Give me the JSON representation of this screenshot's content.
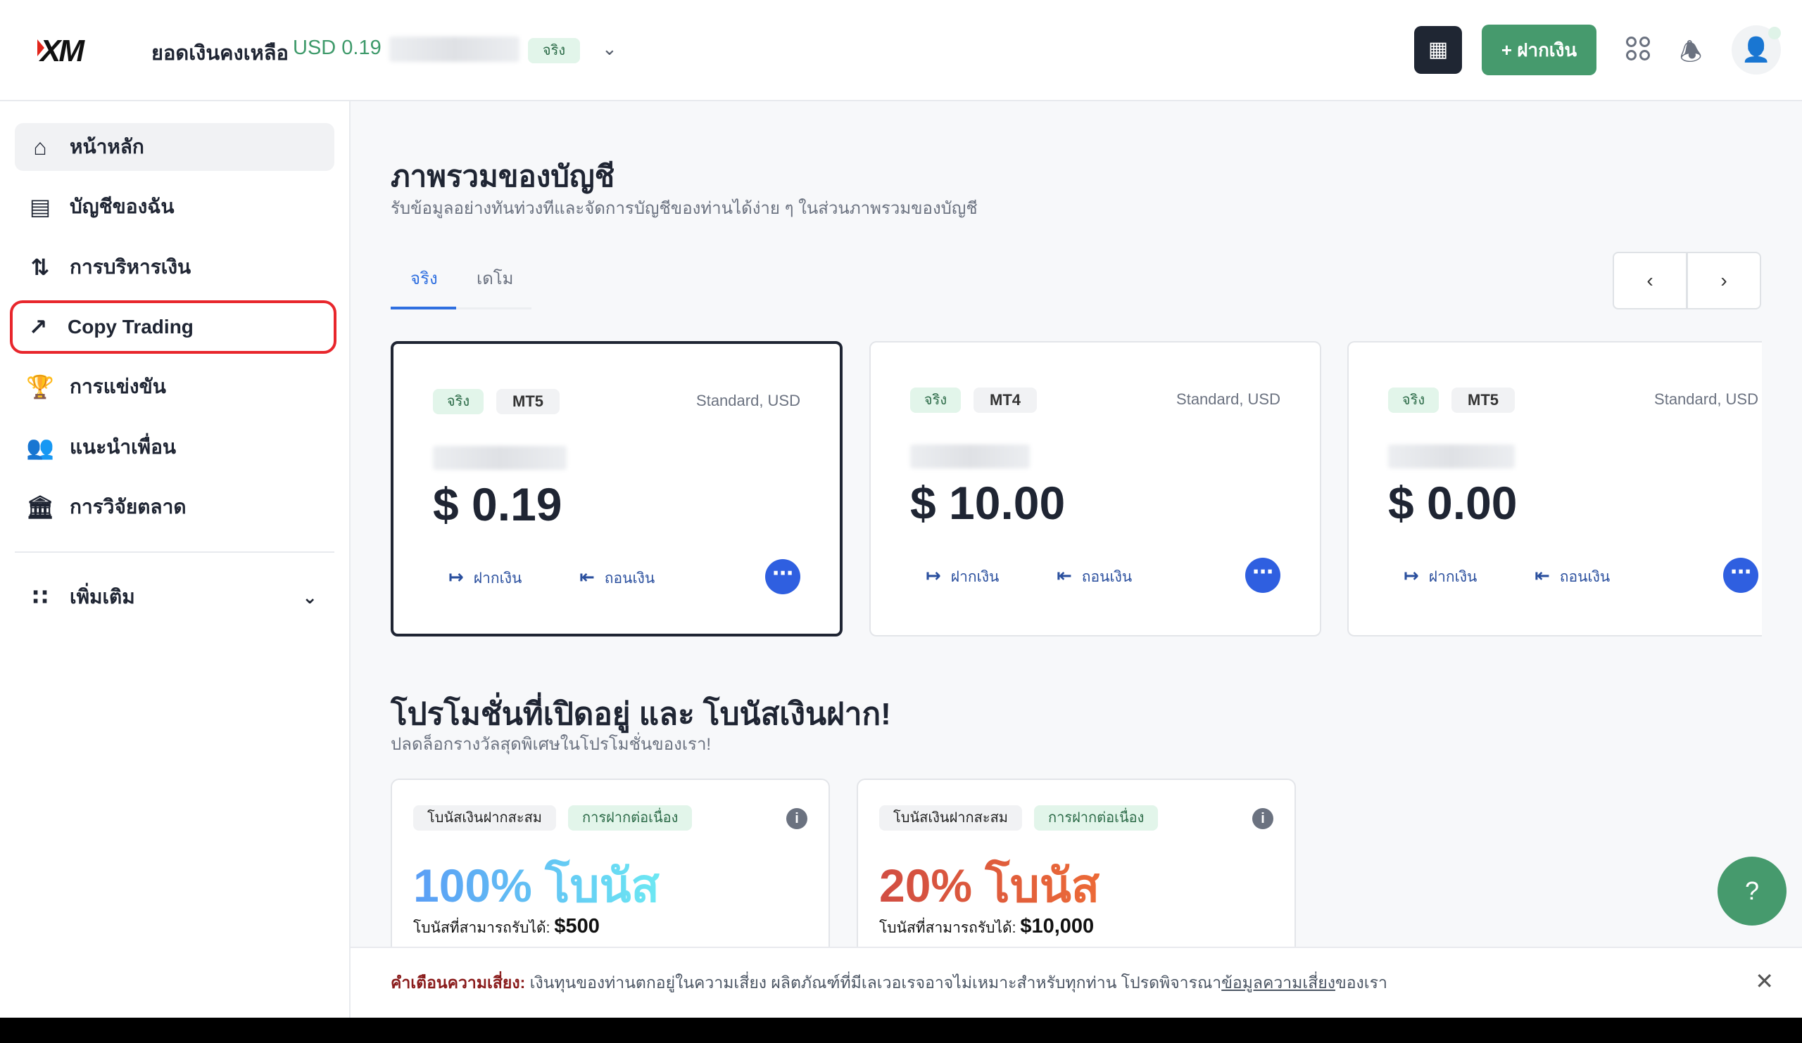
{
  "header": {
    "logo": "XM",
    "balance_label": "ยอดเงินคงเหลือ",
    "balance_value": "USD 0.19",
    "account_badge": "จริง",
    "deposit_button": "+ ฝากเงิน"
  },
  "sidebar": {
    "items": [
      {
        "label": "หน้าหลัก",
        "icon": "home-icon"
      },
      {
        "label": "บัญชีของฉัน",
        "icon": "card-icon"
      },
      {
        "label": "การบริหารเงิน",
        "icon": "transfer-arrows-icon"
      },
      {
        "label": "Copy Trading",
        "icon": "trending-up-icon"
      },
      {
        "label": "การแข่งขัน",
        "icon": "trophy-icon"
      },
      {
        "label": "แนะนำเพื่อน",
        "icon": "users-icon"
      },
      {
        "label": "การวิจัยตลาด",
        "icon": "bank-icon"
      }
    ],
    "more": "เพิ่มเติม"
  },
  "main": {
    "title": "ภาพรวมของบัญชี",
    "subtitle": "รับข้อมูลอย่างทันท่วงทีและจัดการบัญชีของท่านได้ง่าย ๆ ในส่วนภาพรวมของบัญชี",
    "tabs": [
      {
        "label": "จริง"
      },
      {
        "label": "เดโม"
      }
    ],
    "accounts": [
      {
        "badge": "จริง",
        "platform": "MT5",
        "type": "Standard, USD",
        "amount": "$ 0.19"
      },
      {
        "badge": "จริง",
        "platform": "MT4",
        "type": "Standard, USD",
        "amount": "$ 10.00"
      },
      {
        "badge": "จริง",
        "platform": "MT5",
        "type": "Standard, USD",
        "amount": "$ 0.00"
      }
    ],
    "deposit_label": "ฝากเงิน",
    "withdraw_label": "ถอนเงิน"
  },
  "promos": {
    "title": "โปรโมชั่นที่เปิดอยู่ และ โบนัสเงินฝาก!",
    "subtitle": "ปลดล็อกรางวัลสุดพิเศษในโปรโมชั่นของเรา!",
    "cards": [
      {
        "tag1": "โบนัสเงินฝากสะสม",
        "tag2": "การฝากต่อเนื่อง",
        "headline": "100% โบนัส",
        "max_label": "โบนัสที่สามารถรับได้:",
        "max_value": "$500"
      },
      {
        "tag1": "โบนัสเงินฝากสะสม",
        "tag2": "การฝากต่อเนื่อง",
        "headline": "20% โบนัส",
        "max_label": "โบนัสที่สามารถรับได้:",
        "max_value": "$10,000"
      }
    ]
  },
  "footer": {
    "warning_label": "คำเตือนความเสี่ยง:",
    "warning_text": " เงินทุนของท่านตกอยู่ในความเสี่ยง ผลิตภัณฑ์ที่มีเลเวอเรจอาจไม่เหมาะสำหรับทุกท่าน โปรดพิจารณา",
    "link": "ข้อมูลความเสี่ยง",
    "suffix": "ของเรา"
  },
  "colors": {
    "accent_green": "#469a6d",
    "accent_blue": "#2f6fe0",
    "highlight_red": "#e8262c"
  }
}
